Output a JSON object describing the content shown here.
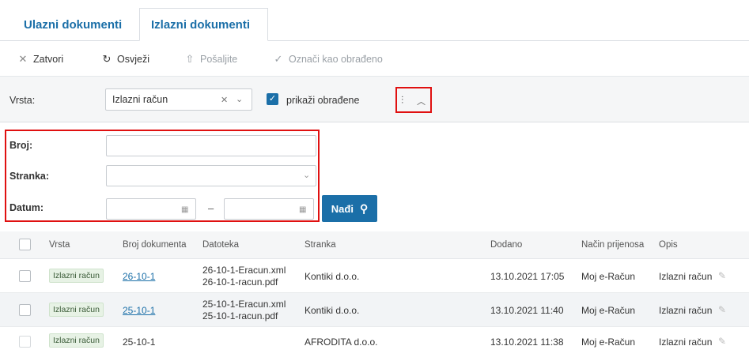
{
  "tabs": [
    {
      "label": "Ulazni dokumenti"
    },
    {
      "label": "Izlazni dokumenti"
    }
  ],
  "toolbar": {
    "close_label": "Zatvori",
    "refresh_label": "Osvježi",
    "send_label": "Pošaljite",
    "mark_label": "Označi kao obrađeno"
  },
  "filter": {
    "vrsta_label": "Vrsta:",
    "vrsta_value": "Izlazni račun",
    "show_processed_label": "prikaži obrađene"
  },
  "search": {
    "broj_label": "Broj:",
    "stranka_label": "Stranka:",
    "datum_label": "Datum:",
    "range_dash": "–",
    "find_label": "Nađi"
  },
  "table": {
    "headers": [
      "Vrsta",
      "Broj dokumenta",
      "Datoteka",
      "Stranka",
      "Dodano",
      "Način prijenosa",
      "Opis"
    ],
    "rows": [
      {
        "vrsta": "Izlazni račun",
        "broj": "26-10-1",
        "file1": "26-10-1-Eracun.xml",
        "file2": "26-10-1-racun.pdf",
        "stranka": "Kontiki d.o.o.",
        "dodano": "13.10.2021 17:05",
        "nacin": "Moj e-Račun",
        "opis": "Izlazni račun"
      },
      {
        "vrsta": "Izlazni račun",
        "broj": "25-10-1",
        "file1": "25-10-1-Eracun.xml",
        "file2": "25-10-1-racun.pdf",
        "stranka": "Kontiki d.o.o.",
        "dodano": "13.10.2021 11:40",
        "nacin": "Moj e-Račun",
        "opis": "Izlazni račun"
      },
      {
        "vrsta": "Izlazni račun",
        "broj": "25-10-1",
        "file1": "",
        "file2": "",
        "stranka": "AFRODITA d.o.o.",
        "dodano": "13.10.2021 11:38",
        "nacin": "Moj e-Račun",
        "opis": "Izlazni račun"
      }
    ]
  },
  "colors": {
    "accent": "#1b6fa8",
    "highlight": "#e01010",
    "badge_bg": "#e7f2e5"
  }
}
